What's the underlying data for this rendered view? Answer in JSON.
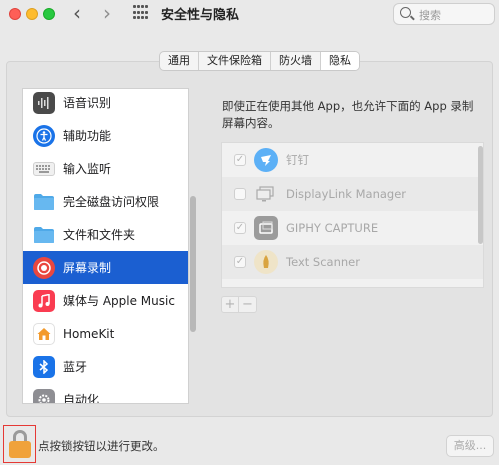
{
  "window": {
    "title": "安全性与隐私",
    "search_placeholder": "搜索"
  },
  "tabs": [
    {
      "label": "通用",
      "active": false
    },
    {
      "label": "文件保险箱",
      "active": false
    },
    {
      "label": "防火墙",
      "active": false
    },
    {
      "label": "隐私",
      "active": true
    }
  ],
  "sidebar": {
    "items": [
      {
        "label": "语音识别",
        "icon": "waveform-icon"
      },
      {
        "label": "辅助功能",
        "icon": "accessibility-icon"
      },
      {
        "label": "输入监听",
        "icon": "keyboard-icon"
      },
      {
        "label": "完全磁盘访问权限",
        "icon": "folder-icon"
      },
      {
        "label": "文件和文件夹",
        "icon": "folder-icon"
      },
      {
        "label": "屏幕录制",
        "icon": "screen-record-icon",
        "selected": true
      },
      {
        "label": "媒体与 Apple Music",
        "icon": "music-icon"
      },
      {
        "label": "HomeKit",
        "icon": "home-icon"
      },
      {
        "label": "蓝牙",
        "icon": "bluetooth-icon"
      },
      {
        "label": "自动化",
        "icon": "gear-icon"
      }
    ]
  },
  "main": {
    "description": "即使正在使用其他 App，也允许下面的 App 录制屏幕内容。",
    "apps": [
      {
        "name": "钉钉",
        "checked": true,
        "icon": "dingtalk-icon"
      },
      {
        "name": "DisplayLink Manager",
        "checked": false,
        "icon": "displaylink-icon"
      },
      {
        "name": "GIPHY CAPTURE",
        "checked": true,
        "icon": "giphy-icon"
      },
      {
        "name": "Text Scanner",
        "checked": true,
        "icon": "text-scanner-icon"
      }
    ],
    "add_label": "+",
    "remove_label": "−"
  },
  "footer": {
    "lock_text": "点按锁按钮以进行更改。",
    "advanced_label": "高级..."
  },
  "colors": {
    "selection": "#1b5fd1",
    "lock": "#f0a23b",
    "highlight_box": "#e53935"
  }
}
